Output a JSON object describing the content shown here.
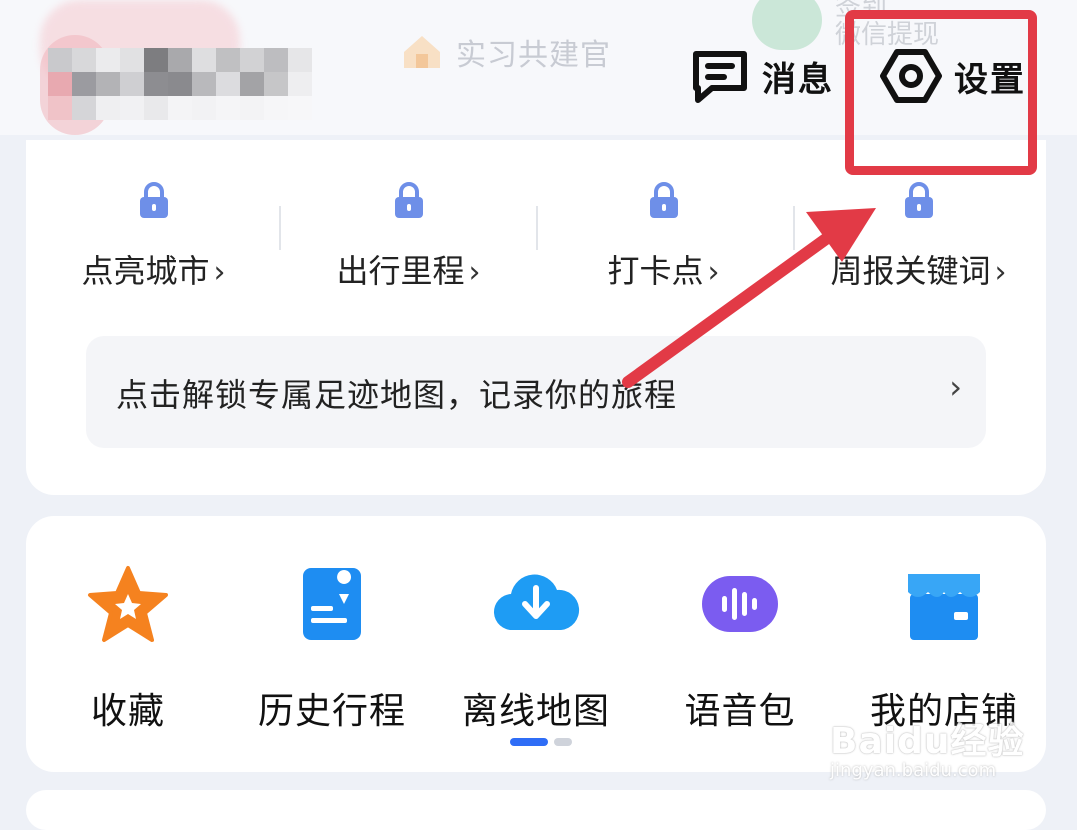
{
  "header": {
    "role_badge_label": "实习共建官",
    "faded_top_text": "微信提现",
    "faded_top_text2": "签到",
    "messages_label": "消息",
    "settings_label": "设置"
  },
  "footprint": {
    "stats": [
      {
        "label": "点亮城市"
      },
      {
        "label": "出行里程"
      },
      {
        "label": "打卡点"
      },
      {
        "label": "周报关键词"
      }
    ],
    "chevron": "›",
    "banner_text": "点击解锁专属足迹地图，记录你的旅程",
    "banner_chevron": "›"
  },
  "tools": {
    "items": [
      {
        "label": "收藏",
        "icon": "star-icon"
      },
      {
        "label": "历史行程",
        "icon": "trip-history-icon"
      },
      {
        "label": "离线地图",
        "icon": "cloud-download-icon"
      },
      {
        "label": "语音包",
        "icon": "voice-pack-icon"
      },
      {
        "label": "我的店铺",
        "icon": "shop-icon"
      }
    ],
    "active_page": 1,
    "page_count": 2
  },
  "annotation": {
    "highlight_color": "#e23a46",
    "target": "设置"
  },
  "watermark": {
    "brand": "Baidu经验",
    "url": "jingyan.baidu.com"
  },
  "colors": {
    "accent_blue": "#2f6df6",
    "star_orange": "#f5821f",
    "voice_purple": "#7b5cf0"
  }
}
